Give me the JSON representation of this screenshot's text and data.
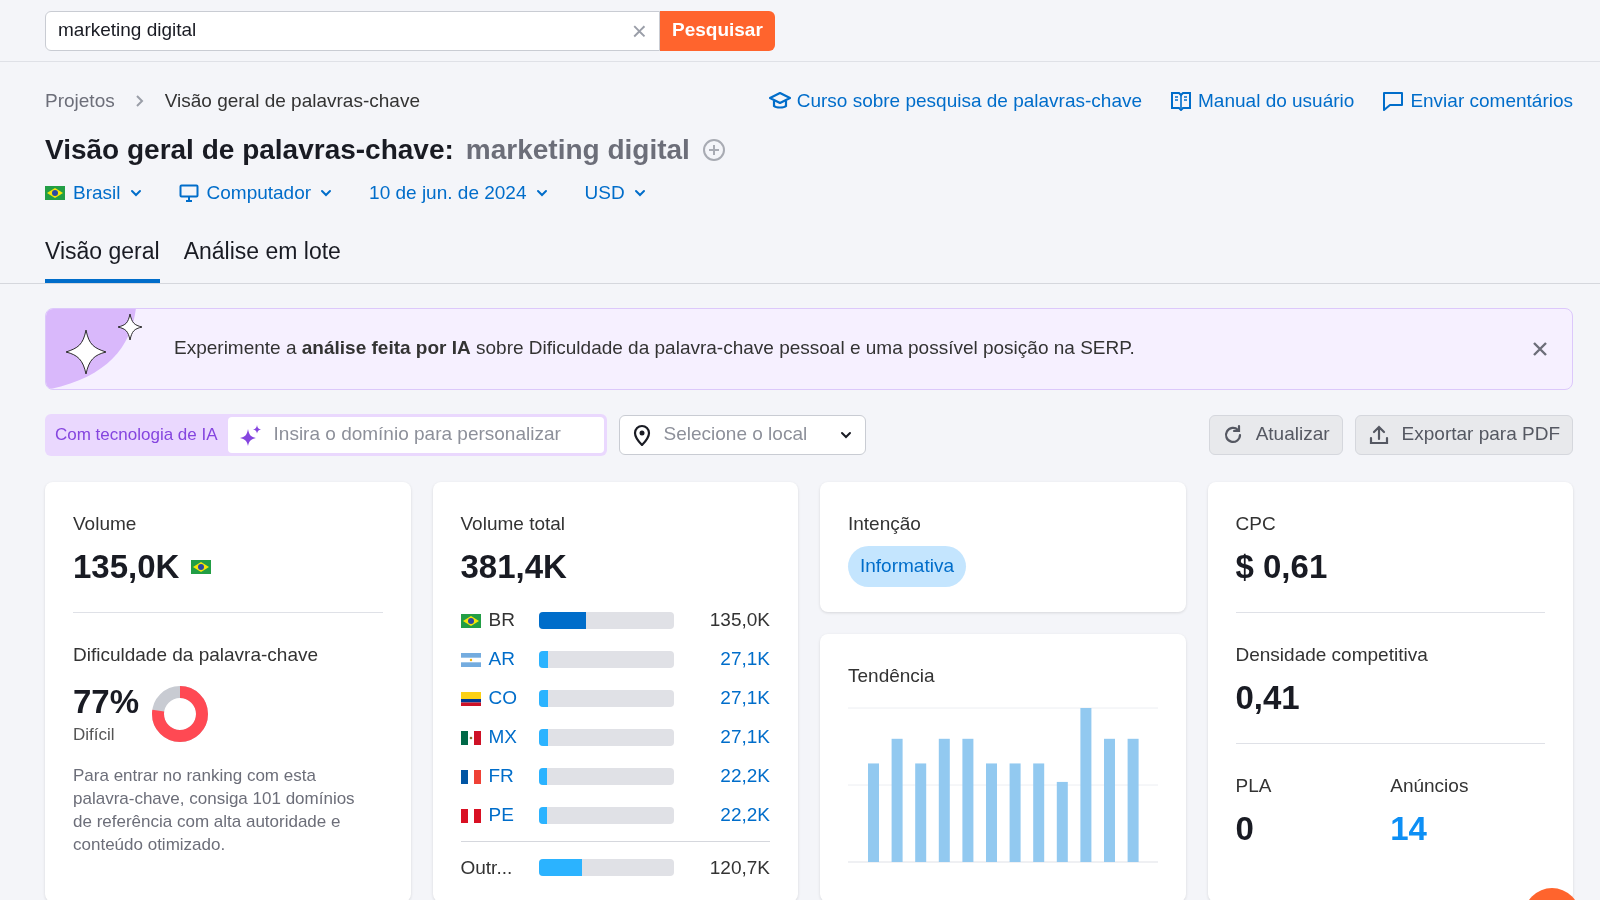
{
  "search": {
    "value": "marketing digital",
    "clear": "×",
    "button": "Pesquisar"
  },
  "breadcrumbs": [
    {
      "label": "Projetos"
    },
    {
      "label": "Visão geral de palavras-chave"
    }
  ],
  "links": [
    {
      "label": "Curso sobre pesquisa de palavras-chave",
      "kind": "course"
    },
    {
      "label": "Manual do usuário",
      "kind": "manual"
    },
    {
      "label": "Enviar comentários",
      "kind": "feedback"
    }
  ],
  "title": "Visão geral de palavras-chave:",
  "keyword": "marketing digital",
  "filters": [
    {
      "label": "Brasil",
      "kind": "flag"
    },
    {
      "label": "Computador",
      "kind": "device"
    },
    {
      "label": "10 de jun. de 2024",
      "kind": "plain"
    },
    {
      "label": "USD",
      "kind": "plain"
    }
  ],
  "tabs": [
    {
      "label": "Visão geral",
      "selected": true
    },
    {
      "label": "Análise em lote",
      "selected": false
    }
  ],
  "banner": {
    "text": "Experimente a **análise feita por IA** sobre Dificuldade da palavra-chave pessoal e uma possível posição na SERP."
  },
  "ai_bar": {
    "badge": "Com tecnologia de IA",
    "placeholder": "Insira o domínio para personalizar",
    "location_placeholder": "Selecione o local"
  },
  "actions": [
    {
      "label": "Atualizar",
      "kind": "refresh"
    },
    {
      "label": "Exportar para PDF",
      "kind": "export"
    }
  ],
  "volume": {
    "label": "Volume",
    "value": "135,0K",
    "difficulty_label": "Dificuldade da palavra-chave",
    "difficulty": "77%",
    "difficulty_gauge": {
      "level": 0.77
    },
    "difficulty_text": "Difícil",
    "hint": "Para entrar no ranking com esta palavra-chave, consiga 101 domínios de referência com alta autoridade e conteúdo otimizado."
  },
  "total_volume": {
    "label": "Volume total",
    "value": "381,4K",
    "countries": [
      {
        "code": "BR",
        "kind": "br",
        "value": "135,0K",
        "level": 0.35,
        "link": false
      },
      {
        "code": "AR",
        "kind": "ar",
        "value": "27,1K",
        "level": 0.07,
        "link": true
      },
      {
        "code": "CO",
        "kind": "co",
        "value": "27,1K",
        "level": 0.07,
        "link": true
      },
      {
        "code": "MX",
        "kind": "mx",
        "value": "27,1K",
        "level": 0.07,
        "link": true
      },
      {
        "code": "FR",
        "kind": "fr",
        "value": "22,2K",
        "level": 0.06,
        "link": true
      },
      {
        "code": "PE",
        "kind": "pe",
        "value": "22,2K",
        "level": 0.06,
        "link": true
      }
    ],
    "other": {
      "code": "Outr...",
      "value": "120,7K",
      "level": 0.32
    }
  },
  "intent": {
    "label": "Intenção",
    "badge": "Informativa"
  },
  "trend": {
    "label": "Tendência"
  },
  "cpc": {
    "label": "CPC",
    "value": "$ 0,61",
    "density_label": "Densidade competitiva",
    "density": "0,41",
    "pla_label": "PLA",
    "pla": "0",
    "ads_label": "Anúncios",
    "ads": "14"
  }
}
